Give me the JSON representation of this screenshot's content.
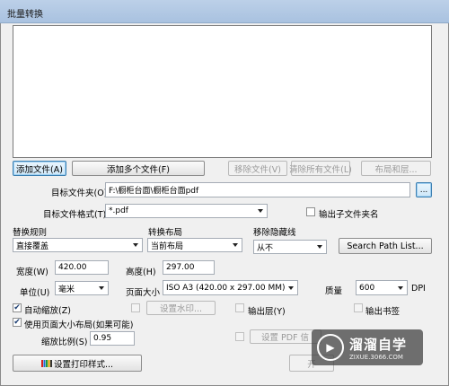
{
  "window": {
    "title": "批量转换"
  },
  "file_buttons": {
    "add_file": "添加文件(A)",
    "add_multiple": "添加多个文件(F)",
    "remove_file": "移除文件(V)",
    "clear_all": "清除所有文件(L)",
    "layout": "布局和层..."
  },
  "target_folder": {
    "label": "目标文件夹(O)",
    "value": "F:\\橱柜台面\\橱柜台面pdf",
    "browse": "..."
  },
  "target_format": {
    "label": "目标文件格式(T)",
    "value": "*.pdf",
    "output_subfolder": "输出子文件夹名",
    "output_subfolder_checked": false
  },
  "replace_rule": {
    "label": "替换规则",
    "value": "直接覆盖"
  },
  "convert_layout": {
    "label": "转换布局",
    "value": "当前布局"
  },
  "remove_hidden": {
    "label": "移除隐藏线",
    "value": "从不"
  },
  "search_path_button": "Search Path List...",
  "width": {
    "label": "宽度(W)",
    "value": "420.00"
  },
  "height": {
    "label": "高度(H)",
    "value": "297.00"
  },
  "unit": {
    "label": "单位(U)",
    "value": "毫米"
  },
  "page_size": {
    "label": "页面大小",
    "value": "ISO A3 (420.00 x 297.00 MM)"
  },
  "quality": {
    "label": "质量",
    "value": "600",
    "unit": "DPI"
  },
  "auto_scale": {
    "label": "自动缩放(Z)",
    "checked": true
  },
  "watermark": {
    "label": "设置水印...",
    "checked": false
  },
  "output_layers": {
    "label": "输出层(Y)",
    "checked": false
  },
  "output_bookmarks": {
    "label": "输出书签",
    "checked": false
  },
  "use_page_size": {
    "label": "使用页面大小布局(如果可能)",
    "checked": true
  },
  "pdf_info": {
    "label": "设置 PDF 信",
    "checked": false
  },
  "scale_ratio": {
    "label": "缩放比例(S)",
    "value": "0.95"
  },
  "print_style_button": "设置打印样式...",
  "start_button": "开",
  "watermark_logo": {
    "cn": "溜溜自学",
    "en": "ZIXUE.3066.COM",
    "icon": "play-icon"
  }
}
